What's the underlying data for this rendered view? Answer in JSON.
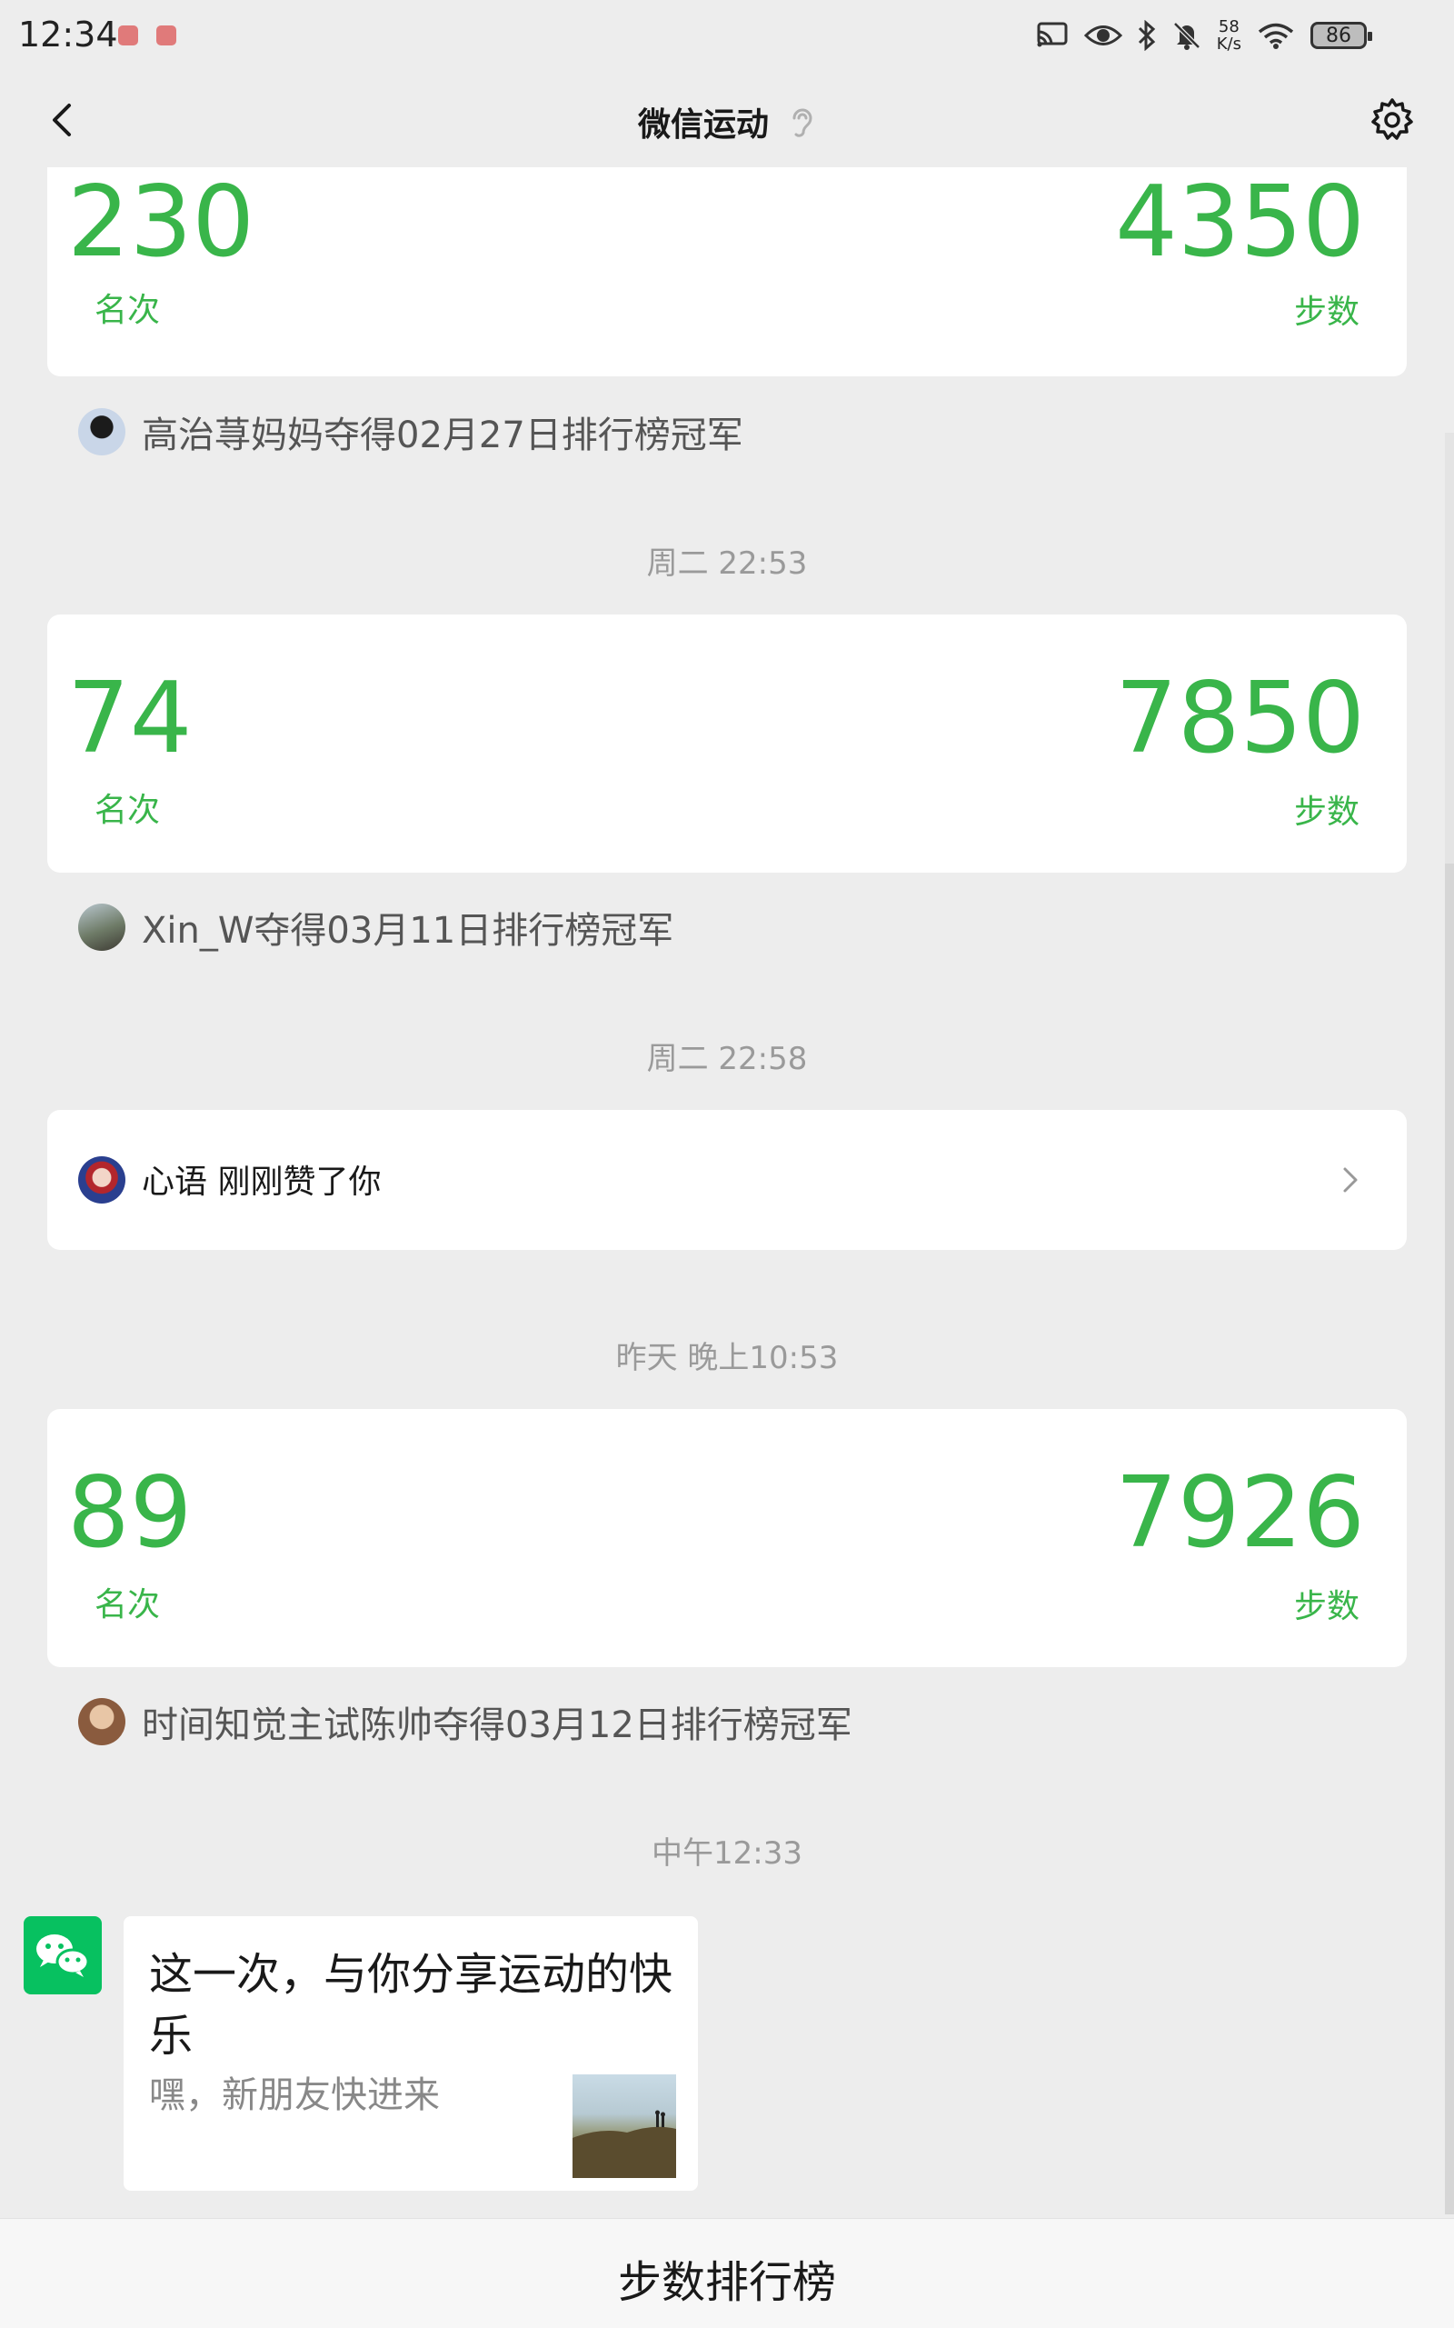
{
  "status_bar": {
    "time": "12:34",
    "net_speed_value": "58",
    "net_speed_unit": "K/s",
    "battery": "86"
  },
  "nav": {
    "title": "微信运动"
  },
  "feed": {
    "rank_cards": [
      {
        "rank": "230",
        "rank_label": "名次",
        "steps": "4350",
        "steps_label": "步数"
      },
      {
        "rank": "74",
        "rank_label": "名次",
        "steps": "7850",
        "steps_label": "步数"
      },
      {
        "rank": "89",
        "rank_label": "名次",
        "steps": "7926",
        "steps_label": "步数"
      }
    ],
    "champions": [
      "高治荨妈妈夺得02月27日排行榜冠军",
      "Xin_W夺得03月11日排行榜冠军",
      "时间知觉主试陈帅夺得03月12日排行榜冠军"
    ],
    "timestamps": [
      "周二 22:53",
      "周二 22:58",
      "昨天 晚上10:53",
      "中午12:33"
    ],
    "like_notice": "心语 刚刚赞了你"
  },
  "message": {
    "title": "这一次，与你分享运动的快乐",
    "subtitle": "嘿，新朋友快进来"
  },
  "bottom_bar": {
    "label": "步数排行榜"
  },
  "colors": {
    "accent_green": "#39b54a",
    "wechat_green": "#07c160",
    "background": "#ededed"
  }
}
